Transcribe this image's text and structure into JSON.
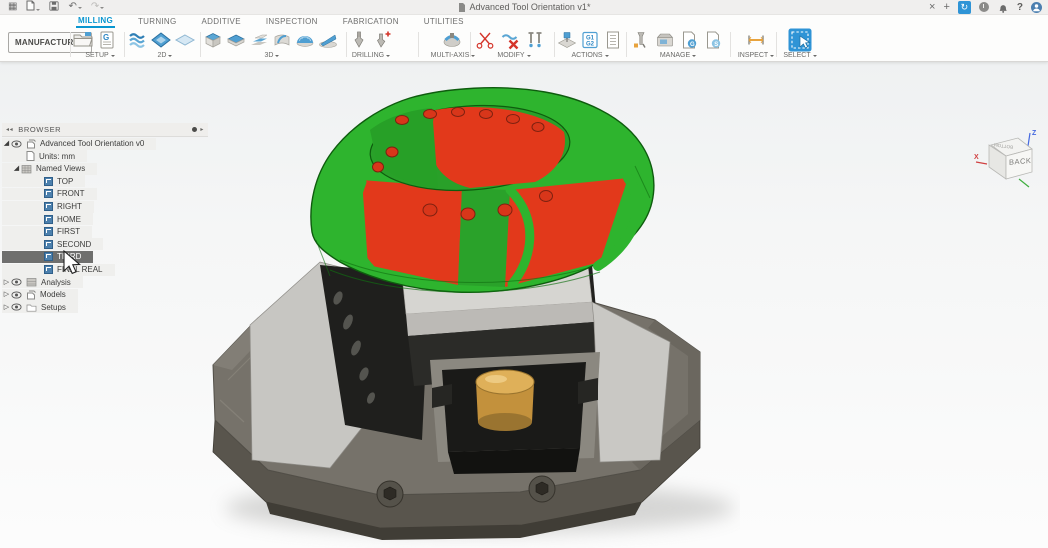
{
  "titlebar": {
    "title": "Advanced Tool Orientation v1*"
  },
  "icons": {
    "app_grid": "▦",
    "undo": "↶",
    "redo": "↷",
    "close": "×",
    "new_tab": "+",
    "sync": "↻",
    "help": "?",
    "collapse": "◂◂",
    "expanded": "◢",
    "collapsed": "▷",
    "panel_more": "▸",
    "post_line1": "G1",
    "post_line2": "G2",
    "post_g": "G",
    "template_s": "S"
  },
  "tabs": [
    {
      "label": "MILLING",
      "active": true
    },
    {
      "label": "TURNING"
    },
    {
      "label": "ADDITIVE"
    },
    {
      "label": "INSPECTION"
    },
    {
      "label": "FABRICATION"
    },
    {
      "label": "UTILITIES"
    }
  ],
  "toolbar": {
    "workspace_label": "MANUFACTURE",
    "groups": {
      "setup": "SETUP",
      "d2": "2D",
      "d3": "3D",
      "drilling": "DRILLING",
      "multiaxis": "MULTI-AXIS",
      "modify": "MODIFY",
      "actions": "ACTIONS",
      "manage": "MANAGE",
      "inspect": "INSPECT",
      "select": "SELECT"
    }
  },
  "browser": {
    "header": "BROWSER",
    "root_label": "Advanced Tool Orientation v0",
    "units_label": "Units: mm",
    "named_views_label": "Named Views",
    "views": [
      "TOP",
      "FRONT",
      "RIGHT",
      "HOME",
      "FIRST",
      "SECOND",
      "THIRD",
      "FINAL REAL"
    ],
    "selected_view": "THIRD",
    "sections": [
      "Analysis",
      "Models",
      "Setups"
    ]
  },
  "viewcube": {
    "front_face": "BACK",
    "top_face": "BOTTOM",
    "axis_x": "X",
    "axis_z": "Z"
  },
  "colors": {
    "accent_blue": "#0a96d0",
    "stock_green": "#2eb42e",
    "rest_material_red": "#e2391b",
    "brass": "#c3913c",
    "selected_row": "#6f6f6e",
    "base_gray": "#76726a"
  }
}
